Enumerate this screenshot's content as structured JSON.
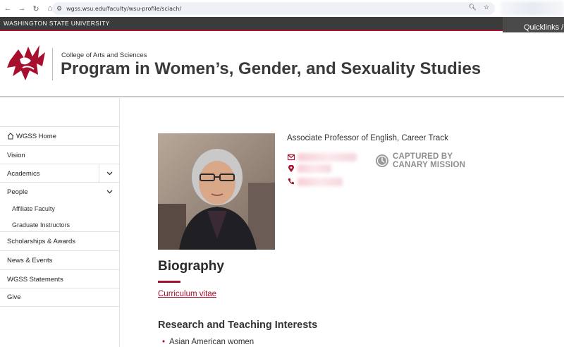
{
  "browser": {
    "url": "wgss.wsu.edu/faculty/wsu-profile/sciach/"
  },
  "top_band": {
    "university": "WASHINGTON STATE UNIVERSITY",
    "quicklinks": "Quicklinks /"
  },
  "header": {
    "college": "College of Arts and Sciences",
    "program": "Program in Women’s, Gender, and Sexuality Studies"
  },
  "sidebar": {
    "items": [
      {
        "label": "WGSS Home"
      },
      {
        "label": "Vision"
      },
      {
        "label": "Academics"
      },
      {
        "label": "People"
      },
      {
        "label": "Affiliate Faculty"
      },
      {
        "label": "Graduate Instructors"
      },
      {
        "label": "Scholarships & Awards"
      },
      {
        "label": "News & Events"
      },
      {
        "label": "WGSS Statements"
      },
      {
        "label": "Give"
      }
    ]
  },
  "profile": {
    "title": "Associate Professor of English, Career Track",
    "watermark_line1": "CAPTURED BY",
    "watermark_line2": "CANARY MISSION"
  },
  "biography": {
    "heading": "Biography",
    "cv_link": "Curriculum vitae",
    "interests_heading": "Research and Teaching Interests",
    "interests": [
      "Asian American women"
    ]
  },
  "colors": {
    "crimson": "#a60f2d",
    "band": "#3b3b3b"
  }
}
